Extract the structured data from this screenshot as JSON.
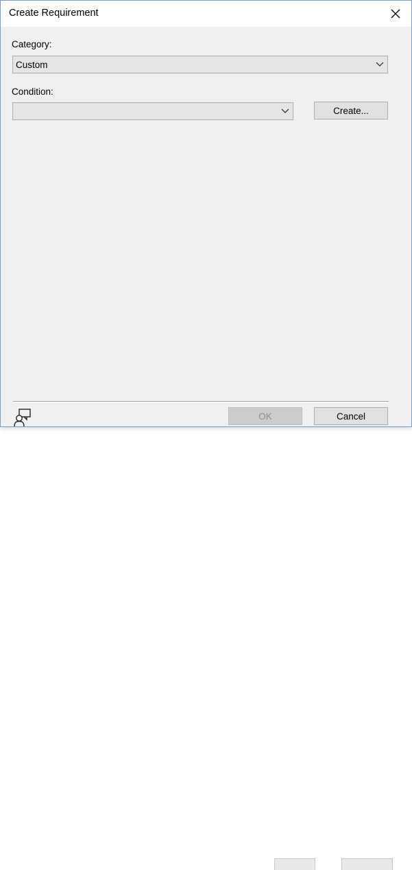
{
  "dialog": {
    "title": "Create Requirement",
    "close_icon": "close-icon"
  },
  "category": {
    "label": "Category:",
    "value": "Custom"
  },
  "condition": {
    "label": "Condition:",
    "value": "",
    "create_button": "Create..."
  },
  "footer": {
    "help_icon": "feedback-person-icon",
    "ok_button": "OK",
    "ok_enabled": false,
    "cancel_button": "Cancel"
  },
  "colors": {
    "dialog_bg": "#f0f0f0",
    "titlebar_bg": "#ffffff",
    "border": "#7a9cc8",
    "combo_bg": "#e5e5e5",
    "button_bg": "#e1e1e1",
    "disabled_button_bg": "#cccccc"
  }
}
